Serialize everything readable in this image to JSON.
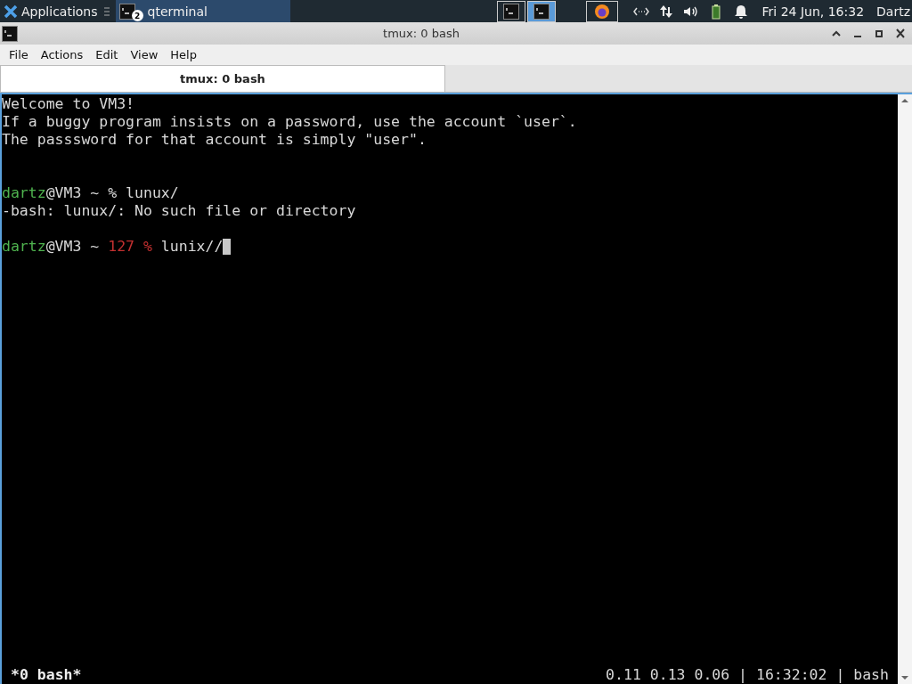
{
  "panel": {
    "apps_label": "Applications",
    "tasks": [
      {
        "label": "qterminal",
        "badge": "2",
        "selected": true
      }
    ],
    "workspaces": [
      {
        "selected": false
      },
      {
        "selected": true
      }
    ],
    "clock": "Fri 24 Jun, 16:32",
    "user": "Dartz"
  },
  "window": {
    "title": "tmux: 0 bash"
  },
  "menu": [
    "File",
    "Actions",
    "Edit",
    "View",
    "Help"
  ],
  "tabs": [
    {
      "label": "tmux: 0 bash",
      "selected": true
    }
  ],
  "terminal": {
    "lines": [
      {
        "kind": "text",
        "segments": [
          {
            "text": "Welcome to VM3!",
            "kind": "normal"
          }
        ]
      },
      {
        "kind": "text",
        "segments": [
          {
            "text": "If a buggy program insists on a password, use the account `user`.",
            "kind": "normal"
          }
        ]
      },
      {
        "kind": "text",
        "segments": [
          {
            "text": "The passsword for that account is simply \"user\".",
            "kind": "normal"
          }
        ]
      },
      {
        "kind": "blank"
      },
      {
        "kind": "blank"
      },
      {
        "kind": "text",
        "segments": [
          {
            "text": "dartz",
            "kind": "user"
          },
          {
            "text": "@VM3 ~ % lunux/",
            "kind": "normal"
          }
        ]
      },
      {
        "kind": "text",
        "segments": [
          {
            "text": "-bash: lunux/: No such file or directory",
            "kind": "normal"
          }
        ]
      },
      {
        "kind": "blank"
      },
      {
        "kind": "text",
        "segments": [
          {
            "text": "dartz",
            "kind": "user"
          },
          {
            "text": "@VM3 ~ ",
            "kind": "normal"
          },
          {
            "text": "127 %",
            "kind": "error"
          },
          {
            "text": " lunix//",
            "kind": "normal"
          }
        ],
        "cursor": true
      }
    ]
  },
  "status_bar": {
    "left": "*0 bash*",
    "right": "0.11 0.13 0.06 | 16:32:02 | bash"
  }
}
